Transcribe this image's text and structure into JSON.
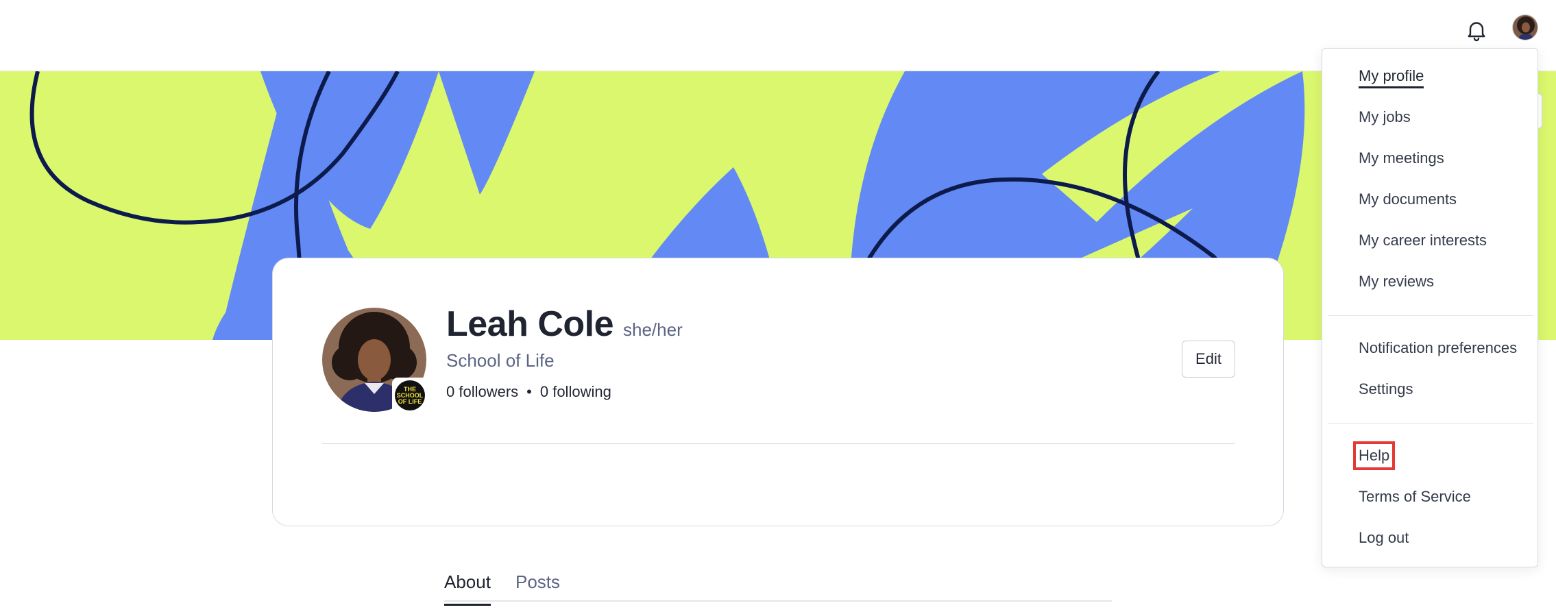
{
  "header": {
    "bell_icon": "bell-icon",
    "avatar_icon": "user-avatar"
  },
  "banner": {
    "colors": {
      "background": "#dbf76e",
      "shape": "#6389f5",
      "line": "#0d1b4c"
    }
  },
  "profile": {
    "name": "Leah Cole",
    "pronouns": "she/her",
    "organization": "School of Life",
    "followers": "0 followers",
    "separator": "•",
    "following": "0 following",
    "edit_label": "Edit",
    "org_badge_text": "THE SCHOOL OF LIFE"
  },
  "tabs": [
    {
      "label": "About",
      "active": true
    },
    {
      "label": "Posts",
      "active": false
    }
  ],
  "menu": {
    "group1": [
      {
        "label": "My profile",
        "active": true
      },
      {
        "label": "My jobs"
      },
      {
        "label": "My meetings"
      },
      {
        "label": "My documents"
      },
      {
        "label": "My career interests"
      },
      {
        "label": "My reviews"
      }
    ],
    "group2": [
      {
        "label": "Notification preferences"
      },
      {
        "label": "Settings"
      }
    ],
    "group3": [
      {
        "label": "Help",
        "highlighted": true
      },
      {
        "label": "Terms of Service"
      },
      {
        "label": "Log out"
      }
    ],
    "highlight_color": "#e53935"
  }
}
